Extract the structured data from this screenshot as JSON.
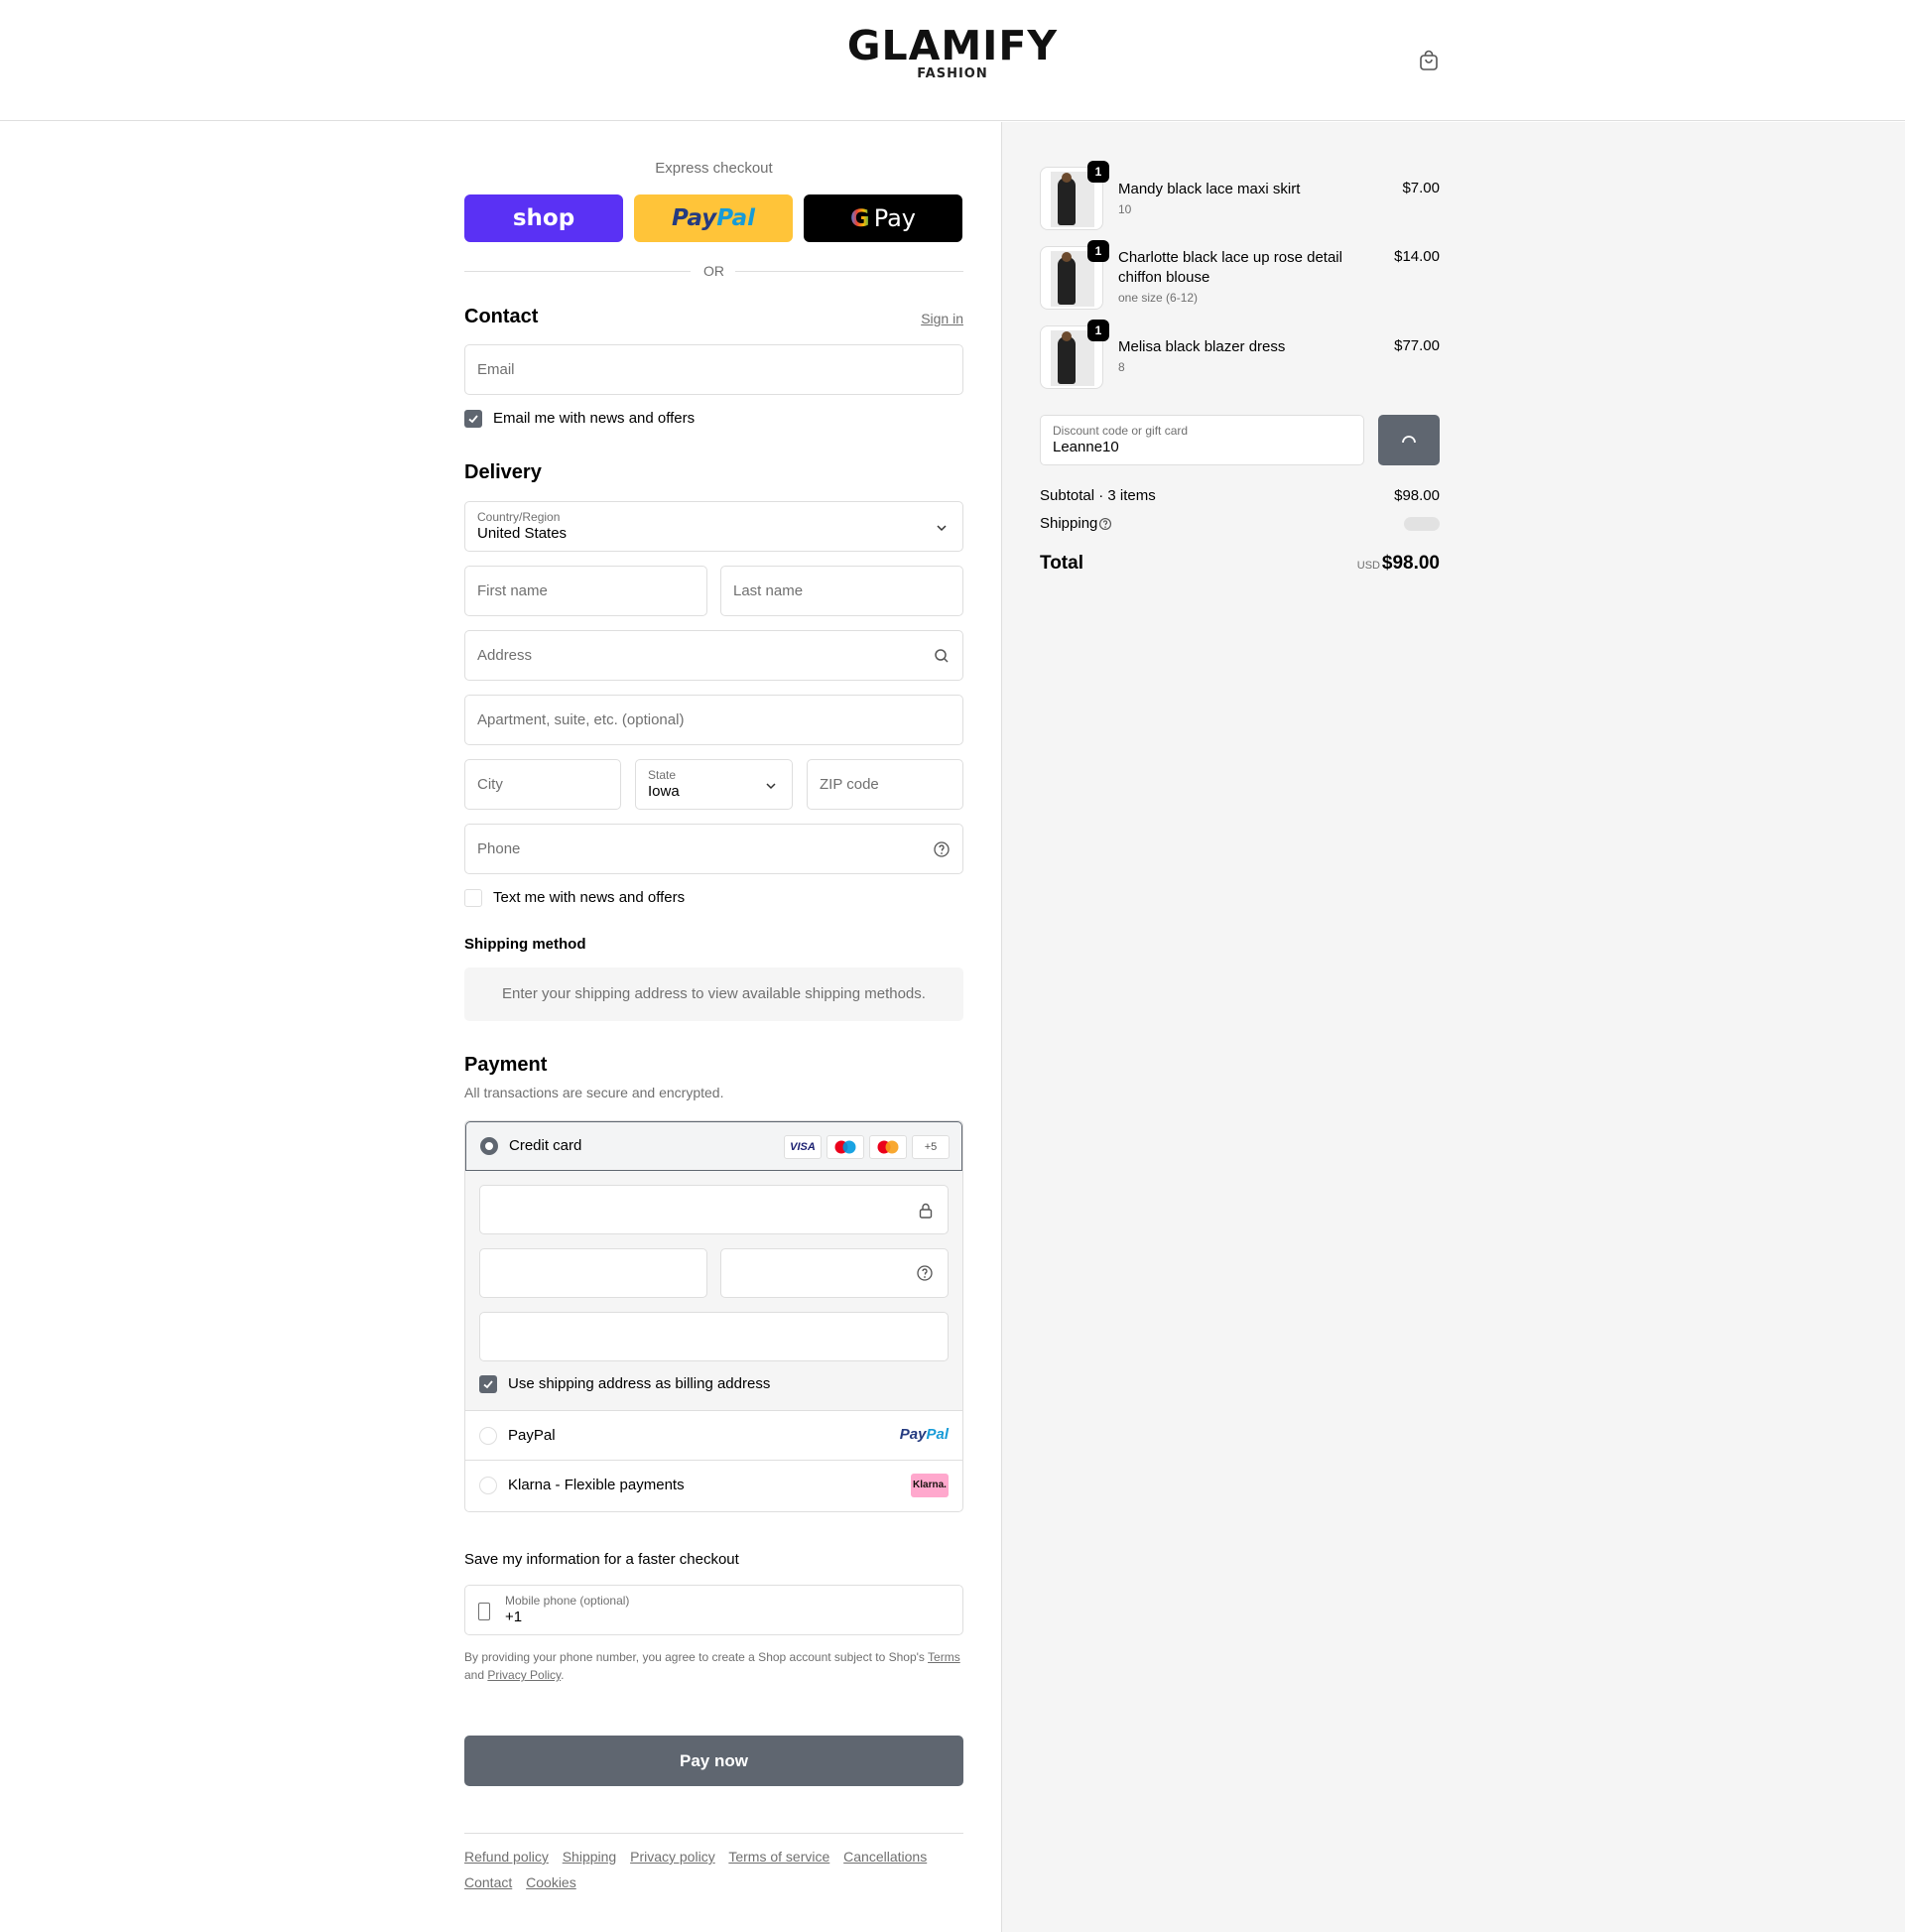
{
  "header": {
    "brand": "GLAMIFY",
    "brand_sub": "FASHION",
    "cart_icon": "shopping-bag-icon"
  },
  "express": {
    "title": "Express checkout",
    "shop_label": "shop",
    "paypal_label_1": "Pay",
    "paypal_label_2": "Pal",
    "gpay_g": "G",
    "gpay_label": "Pay",
    "or": "OR"
  },
  "contact": {
    "title": "Contact",
    "sign_in": "Sign in",
    "email_placeholder": "Email",
    "news_label": "Email me with news and offers",
    "news_checked": true
  },
  "delivery": {
    "title": "Delivery",
    "country_label": "Country/Region",
    "country_value": "United States",
    "first_name": "First name",
    "last_name": "Last name",
    "address": "Address",
    "apartment": "Apartment, suite, etc. (optional)",
    "city": "City",
    "state_label": "State",
    "state_value": "Iowa",
    "zip": "ZIP code",
    "phone": "Phone",
    "text_label": "Text me with news and offers",
    "text_checked": false
  },
  "shipping_method": {
    "title": "Shipping method",
    "message": "Enter your shipping address to view available shipping methods."
  },
  "payment": {
    "title": "Payment",
    "subtitle": "All transactions are secure and encrypted.",
    "credit_card_label": "Credit card",
    "card_badges": [
      "VISA",
      "Maestro",
      "Mastercard",
      "+5"
    ],
    "more_cards": "+5",
    "visa": "VISA",
    "billing_label": "Use shipping address as billing address",
    "billing_checked": true,
    "paypal_label": "PayPal",
    "paypal_logo_1": "Pay",
    "paypal_logo_2": "Pal",
    "klarna_label": "Klarna - Flexible payments",
    "klarna_logo": "Klarna."
  },
  "save_info": {
    "title": "Save my information for a faster checkout",
    "mobile_label": "Mobile phone (optional)",
    "mobile_value": "+1",
    "terms_1": "By providing your phone number, you agree to create a Shop account subject to Shop's ",
    "terms_link": "Terms",
    "terms_2": " and ",
    "privacy_link": "Privacy Policy",
    "terms_3": "."
  },
  "pay_now": "Pay now",
  "footer": {
    "links": [
      "Refund policy",
      "Shipping",
      "Privacy policy",
      "Terms of service",
      "Cancellations",
      "Contact",
      "Cookies"
    ]
  },
  "cart": {
    "items": [
      {
        "name": "Mandy black lace maxi skirt",
        "variant": "10",
        "price": "$7.00",
        "qty": "1"
      },
      {
        "name": "Charlotte black lace up rose detail chiffon blouse",
        "variant": "one size (6-12)",
        "price": "$14.00",
        "qty": "1"
      },
      {
        "name": "Melisa black blazer dress",
        "variant": "8",
        "price": "$77.00",
        "qty": "1"
      }
    ],
    "discount_label": "Discount code or gift card",
    "discount_value": "Leanne10",
    "subtotal_label": "Subtotal · 3 items",
    "subtotal_value": "$98.00",
    "shipping_label": "Shipping",
    "total_label": "Total",
    "currency": "USD",
    "total_value": "$98.00"
  },
  "colors": {
    "shop_purple": "#5a31f4",
    "paypal_yellow": "#ffc439",
    "button_gray": "#5f6670",
    "klarna_pink": "#ffa8cd"
  }
}
